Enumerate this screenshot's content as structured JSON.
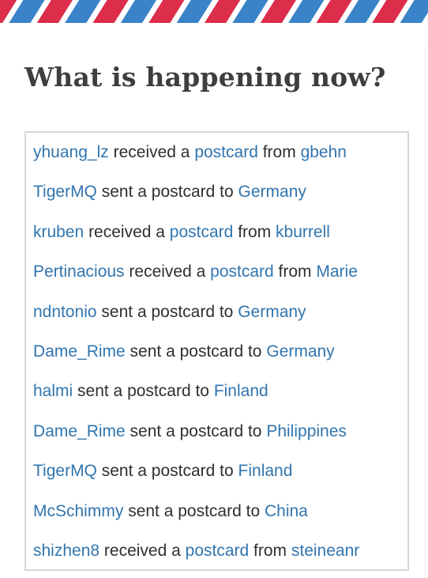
{
  "header": {
    "title": "What is happening now?"
  },
  "feed": {
    "items": [
      {
        "user": "yhuang_lz",
        "action": "received a",
        "object": "postcard",
        "connector": "from",
        "target": "gbehn"
      },
      {
        "user": "TigerMQ",
        "action": "sent a postcard to",
        "target": "Germany"
      },
      {
        "user": "kruben",
        "action": "received a",
        "object": "postcard",
        "connector": "from",
        "target": "kburrell"
      },
      {
        "user": "Pertinacious",
        "action": "received a",
        "object": "postcard",
        "connector": "from",
        "target": "Marie"
      },
      {
        "user": "ndntonio",
        "action": "sent a postcard to",
        "target": "Germany"
      },
      {
        "user": "Dame_Rime",
        "action": "sent a postcard to",
        "target": "Germany"
      },
      {
        "user": "halmi",
        "action": "sent a postcard to",
        "target": "Finland"
      },
      {
        "user": "Dame_Rime",
        "action": "sent a postcard to",
        "target": "Philippines"
      },
      {
        "user": "TigerMQ",
        "action": "sent a postcard to",
        "target": "Finland"
      },
      {
        "user": "McSchimmy",
        "action": "sent a postcard to",
        "target": "China"
      },
      {
        "user": "shizhen8",
        "action": "received a",
        "object": "postcard",
        "connector": "from",
        "target": "steineanr"
      }
    ]
  }
}
